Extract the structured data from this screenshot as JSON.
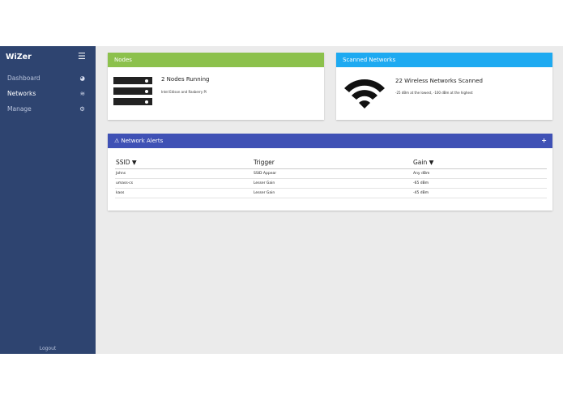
{
  "sidebar": {
    "brand": "WiZer",
    "menu_icon": "hamburger-icon",
    "items": [
      {
        "label": "Dashboard",
        "icon": "dashboard-icon",
        "active": false
      },
      {
        "label": "Networks",
        "icon": "wifi-icon",
        "active": true
      },
      {
        "label": "Manage",
        "icon": "cogs-icon",
        "active": false
      }
    ],
    "logout": "Logout"
  },
  "nodes_card": {
    "title": "Nodes",
    "heading": "2 Nodes Running",
    "subtext": "Intel Edison and Rasberry Pi",
    "color": "#8cc14c"
  },
  "scan_card": {
    "title": "Scanned Networks",
    "heading": "22 Wireless Networks Scanned",
    "subtext": "-25 dBm at the lowest, -100 dBm at the highest",
    "color": "#1eaaf1"
  },
  "alerts": {
    "title": "Network Alerts",
    "warning_icon": "warning-icon",
    "add_icon": "plus-icon",
    "color": "#3f51b5",
    "columns": [
      "SSID ▼",
      "Trigger",
      "Gain ▼"
    ],
    "rows": [
      [
        "Johns",
        "SSID Appear",
        "Any dBm"
      ],
      [
        "umass-cs",
        "Lesser Gain",
        "-65 dBm"
      ],
      [
        "kaos",
        "Lesser Gain",
        "-45 dBm"
      ]
    ]
  }
}
